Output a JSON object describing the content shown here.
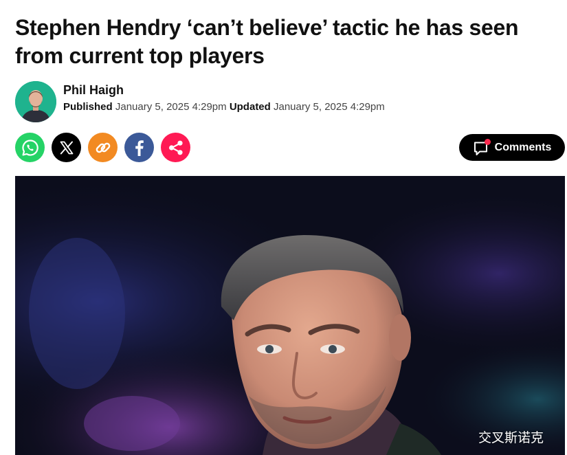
{
  "article": {
    "headline": "Stephen Hendry ‘can’t believe’ tactic he has seen from current top players",
    "author": "Phil Haigh",
    "published_label": "Published",
    "published_date": "January 5, 2025 4:29pm",
    "updated_label": "Updated",
    "updated_date": "January 5, 2025 4:29pm"
  },
  "share": {
    "buttons": [
      {
        "icon": "whatsapp-icon",
        "color": "#25d366"
      },
      {
        "icon": "x-icon",
        "color": "#000000"
      },
      {
        "icon": "link-icon",
        "color": "#f28a22"
      },
      {
        "icon": "facebook-icon",
        "color": "#3b5998"
      },
      {
        "icon": "share-icon",
        "color": "#ff1a54"
      }
    ]
  },
  "comments": {
    "label": "Comments",
    "icon": "comment-icon",
    "badge_color": "#ff2a4f"
  },
  "hero_image": {
    "watermark": "交叉斯诺克"
  }
}
